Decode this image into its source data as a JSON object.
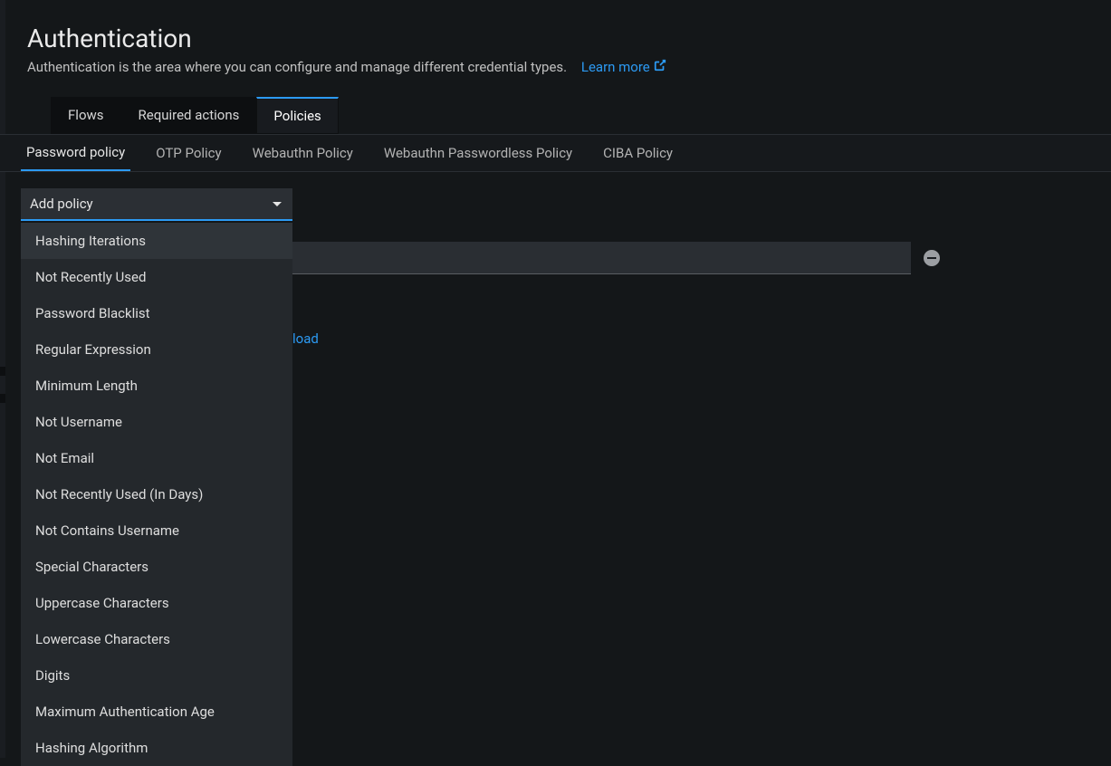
{
  "header": {
    "title": "Authentication",
    "description": "Authentication is the area where you can configure and manage different credential types.",
    "learn_more_label": "Learn more"
  },
  "primary_tabs": [
    {
      "label": "Flows",
      "active": false
    },
    {
      "label": "Required actions",
      "active": false
    },
    {
      "label": "Policies",
      "active": true
    }
  ],
  "secondary_tabs": [
    {
      "label": "Password policy",
      "active": true
    },
    {
      "label": "OTP Policy",
      "active": false
    },
    {
      "label": "Webauthn Policy",
      "active": false
    },
    {
      "label": "Webauthn Passwordless Policy",
      "active": false
    },
    {
      "label": "CIBA Policy",
      "active": false
    }
  ],
  "add_policy": {
    "trigger_label": "Add policy",
    "options": [
      "Hashing Iterations",
      "Not Recently Used",
      "Password Blacklist",
      "Regular Expression",
      "Minimum Length",
      "Not Username",
      "Not Email",
      "Not Recently Used (In Days)",
      "Not Contains Username",
      "Special Characters",
      "Uppercase Characters",
      "Lowercase Characters",
      "Digits",
      "Maximum Authentication Age",
      "Hashing Algorithm"
    ],
    "hovered_index": 0
  },
  "policy_row": {
    "input_value": ""
  },
  "partial_link_fragment": "load",
  "icons": {
    "external_link": "external-link-icon",
    "remove": "minus-circle-icon",
    "caret": "chevron-down-icon"
  }
}
